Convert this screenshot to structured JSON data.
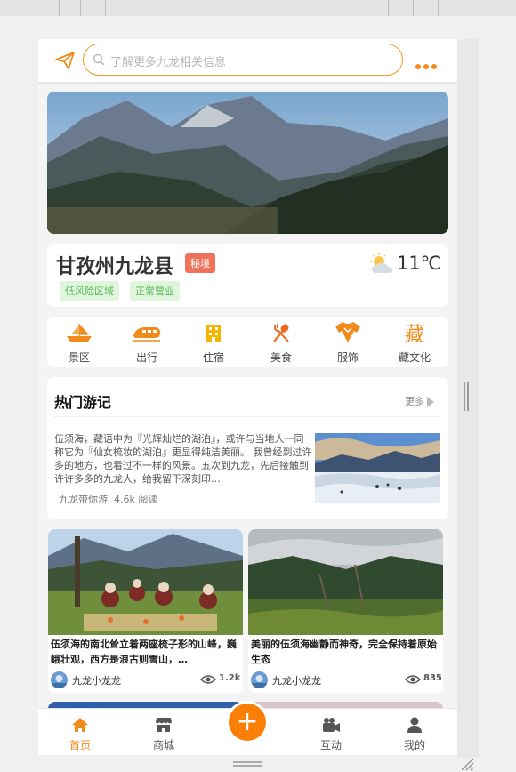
{
  "header": {
    "search_placeholder": "了解更多九龙相关信息",
    "send_icon": "paper-plane-icon",
    "more_icon": "more-dots-icon"
  },
  "location": {
    "name": "甘孜州九龙县",
    "badge": "秘境",
    "tags": [
      "低风险区域",
      "正常营业"
    ],
    "weather_icon": "partly-cloudy-icon",
    "temperature": "11℃"
  },
  "categories": [
    {
      "label": "景区",
      "icon": "boat-icon"
    },
    {
      "label": "出行",
      "icon": "train-icon"
    },
    {
      "label": "住宿",
      "icon": "hotel-icon"
    },
    {
      "label": "美食",
      "icon": "utensils-icon"
    },
    {
      "label": "服饰",
      "icon": "clothing-icon"
    },
    {
      "label": "藏文化",
      "icon": "tibetan-culture-icon",
      "glyph": "藏"
    }
  ],
  "travel_notes": {
    "title": "热门游记",
    "more": "更多",
    "text": "伍须海，藏语中为『光辉灿烂的湖泊』，或许与当地人一同称它为『仙女梳妆的湖泊』更显得纯洁美丽。 我曾经到过许多的地方，也看过不一样的风景。五次到九龙，先后接触到许许多多的九龙人，给我留下深刻印…",
    "author": "九龙带你游",
    "reads": "4.6k 阅读"
  },
  "posts": [
    {
      "title": "伍须海的南北耸立着两座梳子形的山峰，巍峨壮观，西方是浪古则雪山，…",
      "author": "九龙小龙龙",
      "views": "1.2k"
    },
    {
      "title": "美丽的伍须海幽静而神奇，完全保持着原始生态",
      "author": "九龙小龙龙",
      "views": "835"
    }
  ],
  "tabbar": [
    {
      "label": "首页",
      "icon": "home-icon",
      "active": true
    },
    {
      "label": "商城",
      "icon": "store-icon",
      "active": false
    },
    {
      "label": "互动",
      "icon": "video-icon",
      "active": false
    },
    {
      "label": "我的",
      "icon": "user-icon",
      "active": false
    }
  ],
  "colors": {
    "accent": "#f08a1a",
    "badge": "#f1725a",
    "tag_bg": "#dff5dc",
    "tag_text": "#5cb85c"
  }
}
